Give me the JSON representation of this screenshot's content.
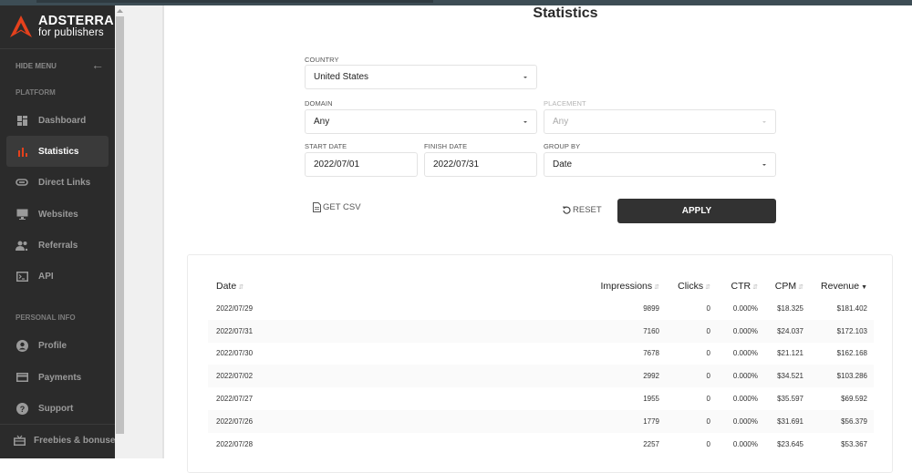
{
  "sidebar": {
    "brand": "ADSTERRA",
    "brand_sub": "for publishers",
    "hide_menu": "HIDE MENU",
    "section_platform": "PLATFORM",
    "section_personal": "PERSONAL INFO",
    "platform_items": [
      {
        "label": "Dashboard",
        "icon": "dashboard-icon"
      },
      {
        "label": "Statistics",
        "icon": "bar-chart-icon",
        "active": true
      },
      {
        "label": "Direct Links",
        "icon": "link-icon"
      },
      {
        "label": "Websites",
        "icon": "monitor-icon"
      },
      {
        "label": "Referrals",
        "icon": "people-icon"
      },
      {
        "label": "API",
        "icon": "terminal-icon"
      }
    ],
    "personal_items": [
      {
        "label": "Profile",
        "icon": "account-icon"
      },
      {
        "label": "Payments",
        "icon": "credit-card-icon"
      },
      {
        "label": "Support",
        "icon": "help-icon"
      }
    ],
    "footer_item": {
      "label": "Freebies & bonuses",
      "icon": "gift-icon"
    },
    "accent_color": "#e5411c"
  },
  "page": {
    "title": "Statistics"
  },
  "filters": {
    "country": {
      "label": "COUNTRY",
      "value": "United States"
    },
    "domain": {
      "label": "DOMAIN",
      "value": "Any"
    },
    "placement": {
      "label": "PLACEMENT",
      "value": "Any",
      "disabled": true
    },
    "start_date": {
      "label": "START DATE",
      "value": "2022/07/01"
    },
    "finish_date": {
      "label": "FINISH DATE",
      "value": "2022/07/31"
    },
    "group_by": {
      "label": "GROUP BY",
      "value": "Date"
    }
  },
  "actions": {
    "get_csv": "GET CSV",
    "reset": "RESET",
    "apply": "APPLY"
  },
  "table": {
    "columns": [
      "Date",
      "Impressions",
      "Clicks",
      "CTR",
      "CPM",
      "Revenue"
    ],
    "sorted_by": "Revenue",
    "sort_direction": "desc",
    "rows": [
      [
        "2022/07/29",
        "9899",
        "0",
        "0.000%",
        "$18.325",
        "$181.402"
      ],
      [
        "2022/07/31",
        "7160",
        "0",
        "0.000%",
        "$24.037",
        "$172.103"
      ],
      [
        "2022/07/30",
        "7678",
        "0",
        "0.000%",
        "$21.121",
        "$162.168"
      ],
      [
        "2022/07/02",
        "2992",
        "0",
        "0.000%",
        "$34.521",
        "$103.286"
      ],
      [
        "2022/07/27",
        "1955",
        "0",
        "0.000%",
        "$35.597",
        "$69.592"
      ],
      [
        "2022/07/26",
        "1779",
        "0",
        "0.000%",
        "$31.691",
        "$56.379"
      ],
      [
        "2022/07/28",
        "2257",
        "0",
        "0.000%",
        "$23.645",
        "$53.367"
      ]
    ]
  }
}
